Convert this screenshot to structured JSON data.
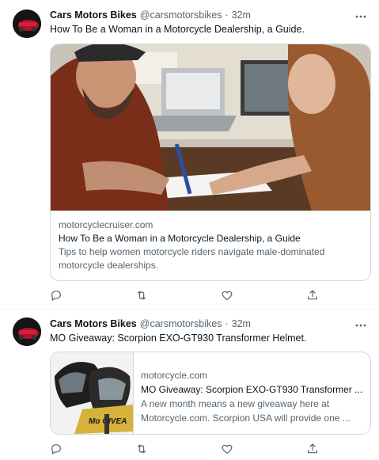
{
  "tweets": [
    {
      "author_name": "Cars Motors Bikes",
      "author_handle": "@carsmotorsbikes",
      "dot": "·",
      "time": "32m",
      "text": "How To Be a Woman in a Motorcycle Dealership, a Guide.",
      "card": {
        "domain": "motorcyclecruiser.com",
        "title": "How To Be a Woman in a Motorcycle Dealership, a Guide",
        "description_line1": "Tips to help women motorcycle riders navigate male-dominated",
        "description_line2": "motorcycle dealerships."
      }
    },
    {
      "author_name": "Cars Motors Bikes",
      "author_handle": "@carsmotorsbikes",
      "dot": "·",
      "time": "32m",
      "text": "MO Giveaway: Scorpion EXO-GT930 Transformer Helmet.",
      "card": {
        "domain": "motorcycle.com",
        "title": "MO Giveaway: Scorpion EXO-GT930 Transformer ...",
        "description_line1": "A new month means a new giveaway here at",
        "description_line2": "Motorcycle.com. Scorpion USA will provide one ...",
        "image_banner_text": "Mo GIVEA"
      }
    }
  ],
  "icons": {
    "more": "more-icon",
    "reply": "reply-icon",
    "retweet": "retweet-icon",
    "like": "like-icon",
    "share": "share-icon"
  },
  "colors": {
    "text_primary": "#0f1419",
    "text_secondary": "#536471",
    "border": "#cfd9de",
    "divider": "#eff3f4"
  }
}
